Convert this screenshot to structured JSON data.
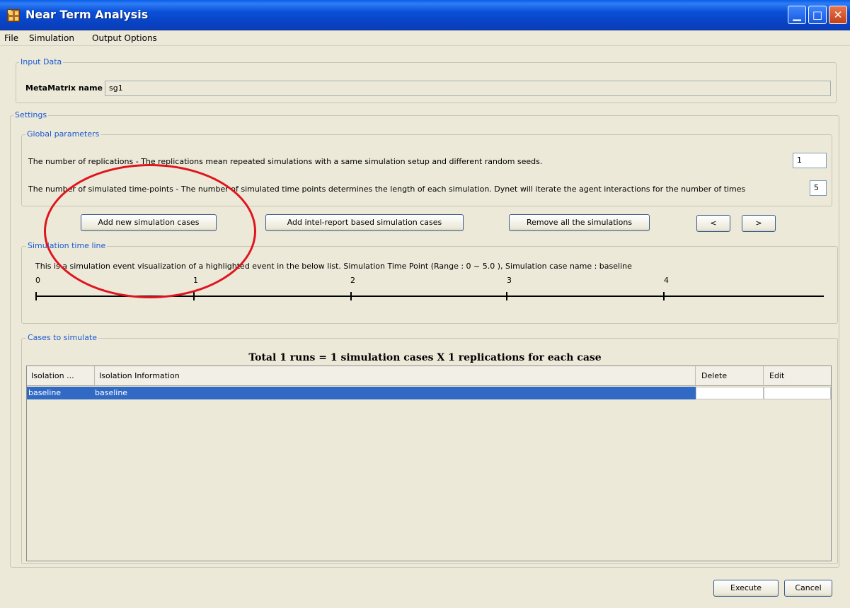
{
  "window": {
    "title": "Near Term Analysis"
  },
  "menu": {
    "items": [
      "File",
      "Simulation",
      "Output Options"
    ]
  },
  "input_data": {
    "legend": "Input Data",
    "metamatrix_label": "MetaMatrix name",
    "metamatrix_value": "sg1"
  },
  "settings": {
    "legend": "Settings",
    "global": {
      "legend": "Global parameters",
      "replications_text": "The number of replications - The replications mean repeated simulations with a same simulation setup and different random seeds.",
      "replications_value": "1",
      "timepoints_text": "The number of simulated time-points - The number of simulated time points determines the length of each simulation. Dynet will iterate the agent interactions for the number of times",
      "timepoints_value": "5"
    },
    "buttons": {
      "add_new": "Add new simulation cases",
      "add_intel": "Add intel-report based simulation cases",
      "remove_all": "Remove all the simulations",
      "prev": "<",
      "next": ">"
    },
    "timeline": {
      "legend": "Simulation time line",
      "description": "This is a simulation event visualization of a highlighted event in the below list. Simulation Time Point (Range : 0 ~ 5.0 ), Simulation case name : baseline",
      "ticks": [
        "0",
        "1",
        "2",
        "3",
        "4"
      ]
    }
  },
  "cases": {
    "legend": "Cases to simulate",
    "summary": "Total 1 runs = 1 simulation cases X 1 replications for each case",
    "columns": [
      "Isolation ...",
      "Isolation Information",
      "Delete",
      "Edit"
    ],
    "rows": [
      {
        "isolation": "baseline",
        "information": "baseline",
        "delete": "",
        "edit": ""
      }
    ]
  },
  "footer": {
    "execute": "Execute",
    "cancel": "Cancel"
  },
  "colors": {
    "title_blue": "#0a4fd8",
    "legend_blue": "#1a58d6",
    "selection": "#316ac5",
    "annotation_red": "#e0141e",
    "background": "#ece9d8"
  }
}
